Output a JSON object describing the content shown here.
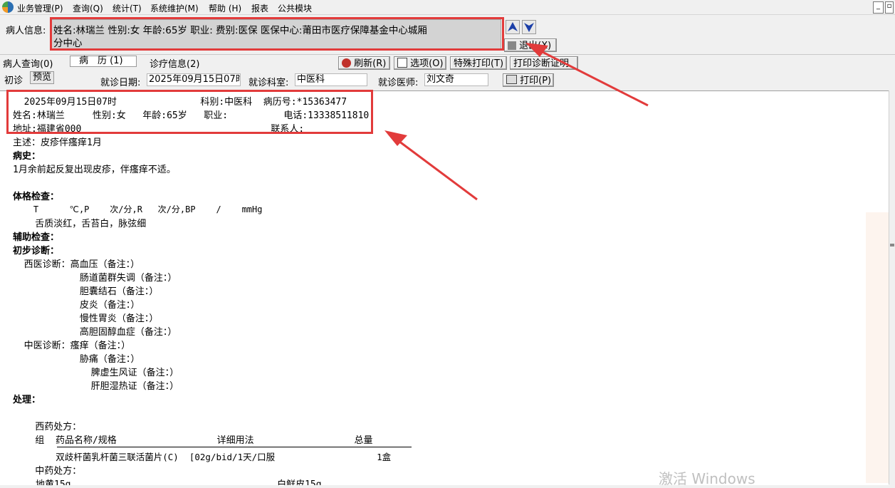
{
  "menu": [
    "业务管理(P)",
    "查询(Q)",
    "统计(T)",
    "系统维护(M)",
    "帮助 (H)",
    "报表",
    "公共模块"
  ],
  "patient_info": {
    "label": "病人信息:",
    "line1": "姓名:林瑞兰  性别:女  年龄:65岁   职业:  费别:医保  医保中心:莆田市医疗保障基金中心城厢",
    "line2": "分中心"
  },
  "exit_button": "退出(X)",
  "tabs": [
    "病人查询(0)",
    "病　历 (1)",
    "诊疗信息(2)"
  ],
  "toolbar": {
    "refresh": "刷新(R)",
    "options": "选项(O)",
    "special_print": "特殊打印(T)",
    "print_cert": "打印诊断证明",
    "print": "打印(P)"
  },
  "visit": {
    "type": "初诊",
    "preview": "预览",
    "date_label": "就诊日期:",
    "date_value": "2025年09月15日07时",
    "dept_label": "就诊科室:",
    "dept_value": "中医科",
    "doctor_label": "就诊医师:",
    "doctor_value": "刘文奇"
  },
  "record": {
    "header1": "  2025年09月15日07时               科别:中医科  病历号:*15363477",
    "header2": "姓名:林瑞兰     性别:女   年龄:65岁   职业:          电话:13338511810",
    "header3": "地址:福建省000                                  联系人:",
    "complaint": "主述：皮疹伴瘙痒1月",
    "history_title": "病史：",
    "history": "1月余前起反复出现皮疹，伴瘙痒不适。",
    "exam_title": "体格检查：",
    "vitals": "    T      ℃,P    次/分,R   次/分,BP    /    mmHg",
    "tongue": "    舌质淡红，舌苔白，脉弦细",
    "aux_title": "辅助检查：",
    "dx_title": "初步诊断：",
    "western_dx": [
      "  西医诊断：高血压（备注：）",
      "            肠道菌群失调（备注：）",
      "            胆囊结石（备注：）",
      "            皮炎（备注：）",
      "            慢性胃炎（备注：）",
      "            高胆固醇血症（备注：）"
    ],
    "tcm_dx": [
      "  中医诊断：瘙痒（备注：）",
      "            胁痛（备注：）",
      "              脾虚生风证（备注：）",
      "              肝胆湿热证（备注：）"
    ],
    "treatment_title": "处理：",
    "western_rx_title": "    西药处方：",
    "rx_header": "    组  药品名称/规格                  详细用法                  总量",
    "rx_row": "        双歧杆菌乳杆菌三联活菌片(C)  [02g/bid/1天/口服                   1盒",
    "tcm_rx_title": "    中药处方：",
    "tcm_rx_row": "地黄15g                                     白鲜皮15g"
  },
  "watermark": "激活 Windows",
  "colors": {
    "annotation_red": "#e23b3b",
    "arrow_blue": "#1c3fa8",
    "refresh_red": "#c0302a"
  }
}
